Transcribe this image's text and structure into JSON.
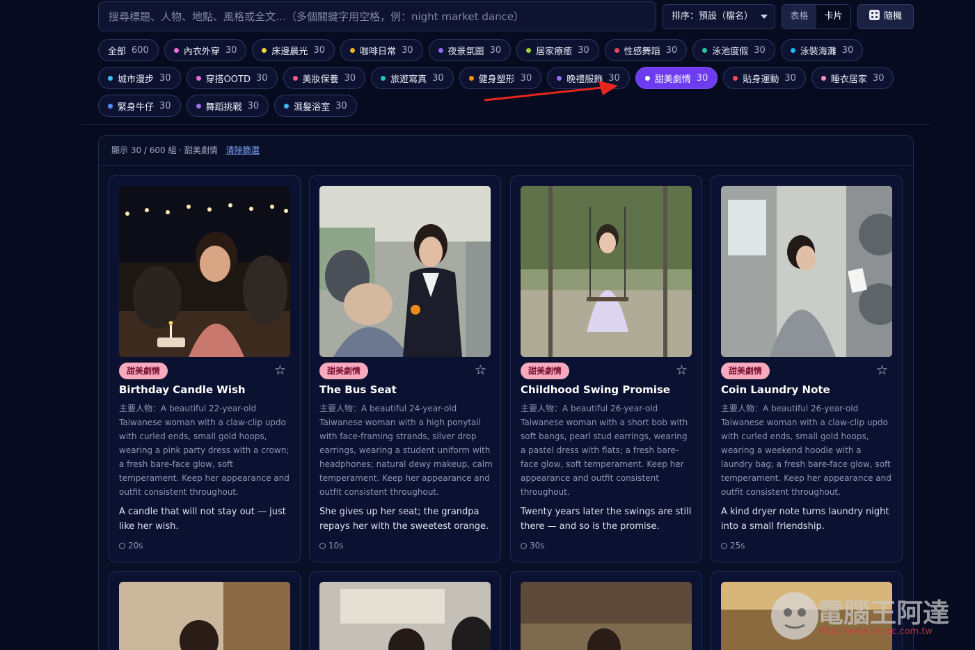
{
  "search": {
    "placeholder": "搜尋標題、人物、地點、風格或全文…（多個關鍵字用空格，例：night market dance）"
  },
  "sort": {
    "label": "排序：預設（檔名）"
  },
  "view": {
    "table": "表格",
    "card": "卡片",
    "selected": "卡片"
  },
  "random_label": "隨機",
  "chips": [
    {
      "label": "全部",
      "count": "600",
      "dot": ""
    },
    {
      "label": "內衣外穿",
      "count": "30",
      "dot": "#f06bd6"
    },
    {
      "label": "床邊晨光",
      "count": "30",
      "dot": "#f7d33c"
    },
    {
      "label": "咖啡日常",
      "count": "30",
      "dot": "#f5b21c"
    },
    {
      "label": "夜景氛圍",
      "count": "30",
      "dot": "#8f6cf6"
    },
    {
      "label": "居家療癒",
      "count": "30",
      "dot": "#9bd43a"
    },
    {
      "label": "性感舞蹈",
      "count": "30",
      "dot": "#f0405f"
    },
    {
      "label": "泳池度假",
      "count": "30",
      "dot": "#23c9a4"
    },
    {
      "label": "泳裝海灘",
      "count": "30",
      "dot": "#22b8f0"
    },
    {
      "label": "城市漫步",
      "count": "30",
      "dot": "#39c3f3"
    },
    {
      "label": "穿搭OOTD",
      "count": "30",
      "dot": "#e96bd9"
    },
    {
      "label": "美妝保養",
      "count": "30",
      "dot": "#f25a8e"
    },
    {
      "label": "旅遊寫真",
      "count": "30",
      "dot": "#26c4b2"
    },
    {
      "label": "健身塑形",
      "count": "30",
      "dot": "#f5921e"
    },
    {
      "label": "晚禮服飾",
      "count": "30",
      "dot": "#9a6cf5"
    },
    {
      "label": "甜美劇情",
      "count": "30",
      "dot": "#ffffff",
      "active": true
    },
    {
      "label": "貼身運動",
      "count": "30",
      "dot": "#f24a5d"
    },
    {
      "label": "睡衣居家",
      "count": "30",
      "dot": "#f592c0"
    },
    {
      "label": "緊身牛仔",
      "count": "30",
      "dot": "#4b8ef5"
    },
    {
      "label": "舞蹈挑戰",
      "count": "30",
      "dot": "#9a6cf5"
    },
    {
      "label": "濕髮浴室",
      "count": "30",
      "dot": "#38b9f0"
    }
  ],
  "results": {
    "summary": "顯示 30 / 600 組 · 甜美劇情",
    "clear_label": "清除篩選"
  },
  "cards": [
    {
      "tag": "甜美劇情",
      "title": "Birthday Candle Wish",
      "description": "主要人物：A beautiful 22-year-old Taiwanese woman with a claw-clip updo with curled ends, small gold hoops, wearing a pink party dress with a crown; a fresh bare-face glow, soft temperament. Keep her appearance and outfit consistent throughout.",
      "tagline": "A candle that will not stay out — just like her wish.",
      "duration": "20s"
    },
    {
      "tag": "甜美劇情",
      "title": "The Bus Seat",
      "description": "主要人物：A beautiful 24-year-old Taiwanese woman with a high ponytail with face-framing strands, silver drop earrings, wearing a student uniform with headphones; natural dewy makeup, calm temperament. Keep her appearance and outfit consistent throughout.",
      "tagline": "She gives up her seat; the grandpa repays her with the sweetest orange.",
      "duration": "10s"
    },
    {
      "tag": "甜美劇情",
      "title": "Childhood Swing Promise",
      "description": "主要人物：A beautiful 26-year-old Taiwanese woman with a short bob with soft bangs, pearl stud earrings, wearing a pastel dress with flats; a fresh bare-face glow, soft temperament. Keep her appearance and outfit consistent throughout.",
      "tagline": "Twenty years later the swings are still there — and so is the promise.",
      "duration": "30s"
    },
    {
      "tag": "甜美劇情",
      "title": "Coin Laundry Note",
      "description": "主要人物：A beautiful 26-year-old Taiwanese woman with a claw-clip updo with curled ends, small gold hoops, wearing a weekend hoodie with a laundry bag; a fresh bare-face glow, soft temperament. Keep her appearance and outfit consistent throughout.",
      "tagline": "A kind dryer note turns laundry night into a small friendship.",
      "duration": "25s"
    }
  ],
  "watermark": {
    "text": "電腦王阿達",
    "url": "http://www.kocpc.com.tw"
  }
}
